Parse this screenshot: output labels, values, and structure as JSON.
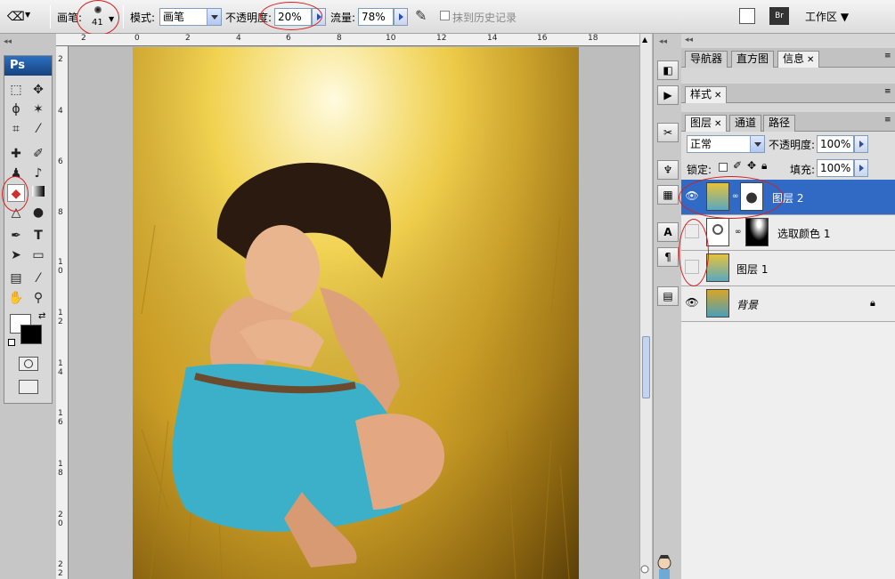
{
  "options_bar": {
    "brush_label": "画笔:",
    "brush_size": "41",
    "mode_label": "模式:",
    "mode_value": "画笔",
    "opacity_label": "不透明度:",
    "opacity_value": "20%",
    "flow_label": "流量:",
    "flow_value": "78%",
    "erase_history_label": "抹到历史记录",
    "workspace_label": "工作区"
  },
  "toolbox": {
    "logo": "Ps"
  },
  "ruler": {
    "h_ticks": [
      "2",
      "0",
      "2",
      "4",
      "6",
      "8",
      "10",
      "12",
      "14",
      "16",
      "18"
    ],
    "v_ticks": [
      "2",
      "4",
      "6",
      "8",
      "1 0",
      "1 2",
      "1 4",
      "1 6",
      "1 8",
      "2 0",
      "2 2"
    ]
  },
  "panels": {
    "group1_tabs": [
      "导航器",
      "直方图",
      "信息"
    ],
    "group2_tabs": [
      "样式"
    ],
    "group3_tabs": [
      "图层",
      "通道",
      "路径"
    ],
    "blend_mode": "正常",
    "opacity_label": "不透明度:",
    "opacity_value": "100%",
    "lock_label": "锁定:",
    "fill_label": "填充:",
    "fill_value": "100%",
    "layers": [
      {
        "name": "图层 2",
        "selected": true
      },
      {
        "name": "选取颜色 1",
        "selected": false
      },
      {
        "name": "图层 1",
        "selected": false
      },
      {
        "name": "背景",
        "selected": false
      }
    ]
  },
  "colors": {
    "selection": "#316ac5",
    "annotation": "#d42020"
  }
}
